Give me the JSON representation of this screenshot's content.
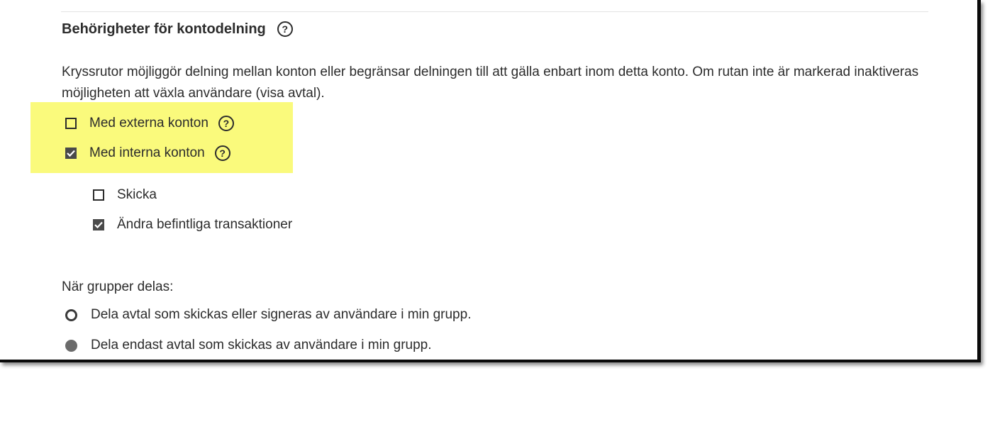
{
  "section": {
    "title": "Behörigheter för kontodelning",
    "description": "Kryssrutor möjliggör delning mellan konton eller begränsar delningen till att gälla enbart inom detta konto. Om rutan inte är markerad inaktiveras möjligheten att växla användare (visa avtal)."
  },
  "options": {
    "external": {
      "label": "Med externa konton",
      "checked": false
    },
    "internal": {
      "label": "Med interna konton",
      "checked": true
    },
    "send": {
      "label": "Skicka",
      "checked": false
    },
    "modify": {
      "label": "Ändra befintliga transaktioner",
      "checked": true
    }
  },
  "groups": {
    "label": "När grupper delas:",
    "radio_options": [
      {
        "label": "Dela avtal som skickas eller signeras av användare i min grupp.",
        "selected": false
      },
      {
        "label": "Dela endast avtal som skickas av användare i min grupp.",
        "selected": true
      }
    ]
  },
  "icons": {
    "help": "question-circle-icon",
    "check": "checkmark-icon"
  },
  "colors": {
    "highlight": "#fafa7c",
    "text": "#2c2c2c"
  }
}
